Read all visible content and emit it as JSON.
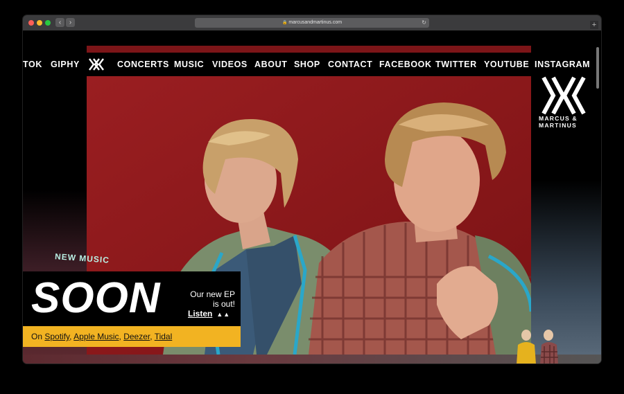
{
  "browser": {
    "url": "marcusandmartinus.com",
    "back_glyph": "‹",
    "forward_glyph": "›",
    "reload_glyph": "↻",
    "new_tab_glyph": "+",
    "lock_glyph": "🔒"
  },
  "nav": {
    "items": [
      "TOK",
      "GIPHY",
      "CONCERTS",
      "MUSIC",
      "VIDEOS",
      "ABOUT",
      "SHOP",
      "CONTACT",
      "FACEBOOK",
      "TWITTER",
      "YOUTUBE",
      "INSTAGRAM"
    ]
  },
  "brand": {
    "line1": "MARCUS &",
    "line2": "MARTINUS"
  },
  "promo": {
    "tag": "NEW MUSIC",
    "headline": "SOON",
    "line1": "Our new EP",
    "line2": "is out!",
    "listen": "Listen",
    "listen_icon": "▲▲"
  },
  "streaming": {
    "prefix": "On",
    "services": [
      "Spotify",
      "Apple Music",
      "Deezer",
      "Tidal"
    ],
    "sep": ", "
  },
  "colors": {
    "hero_red": "#8e1a1d",
    "promo_yellow": "#f2b322",
    "new_music_mint": "#b9f0e4"
  }
}
